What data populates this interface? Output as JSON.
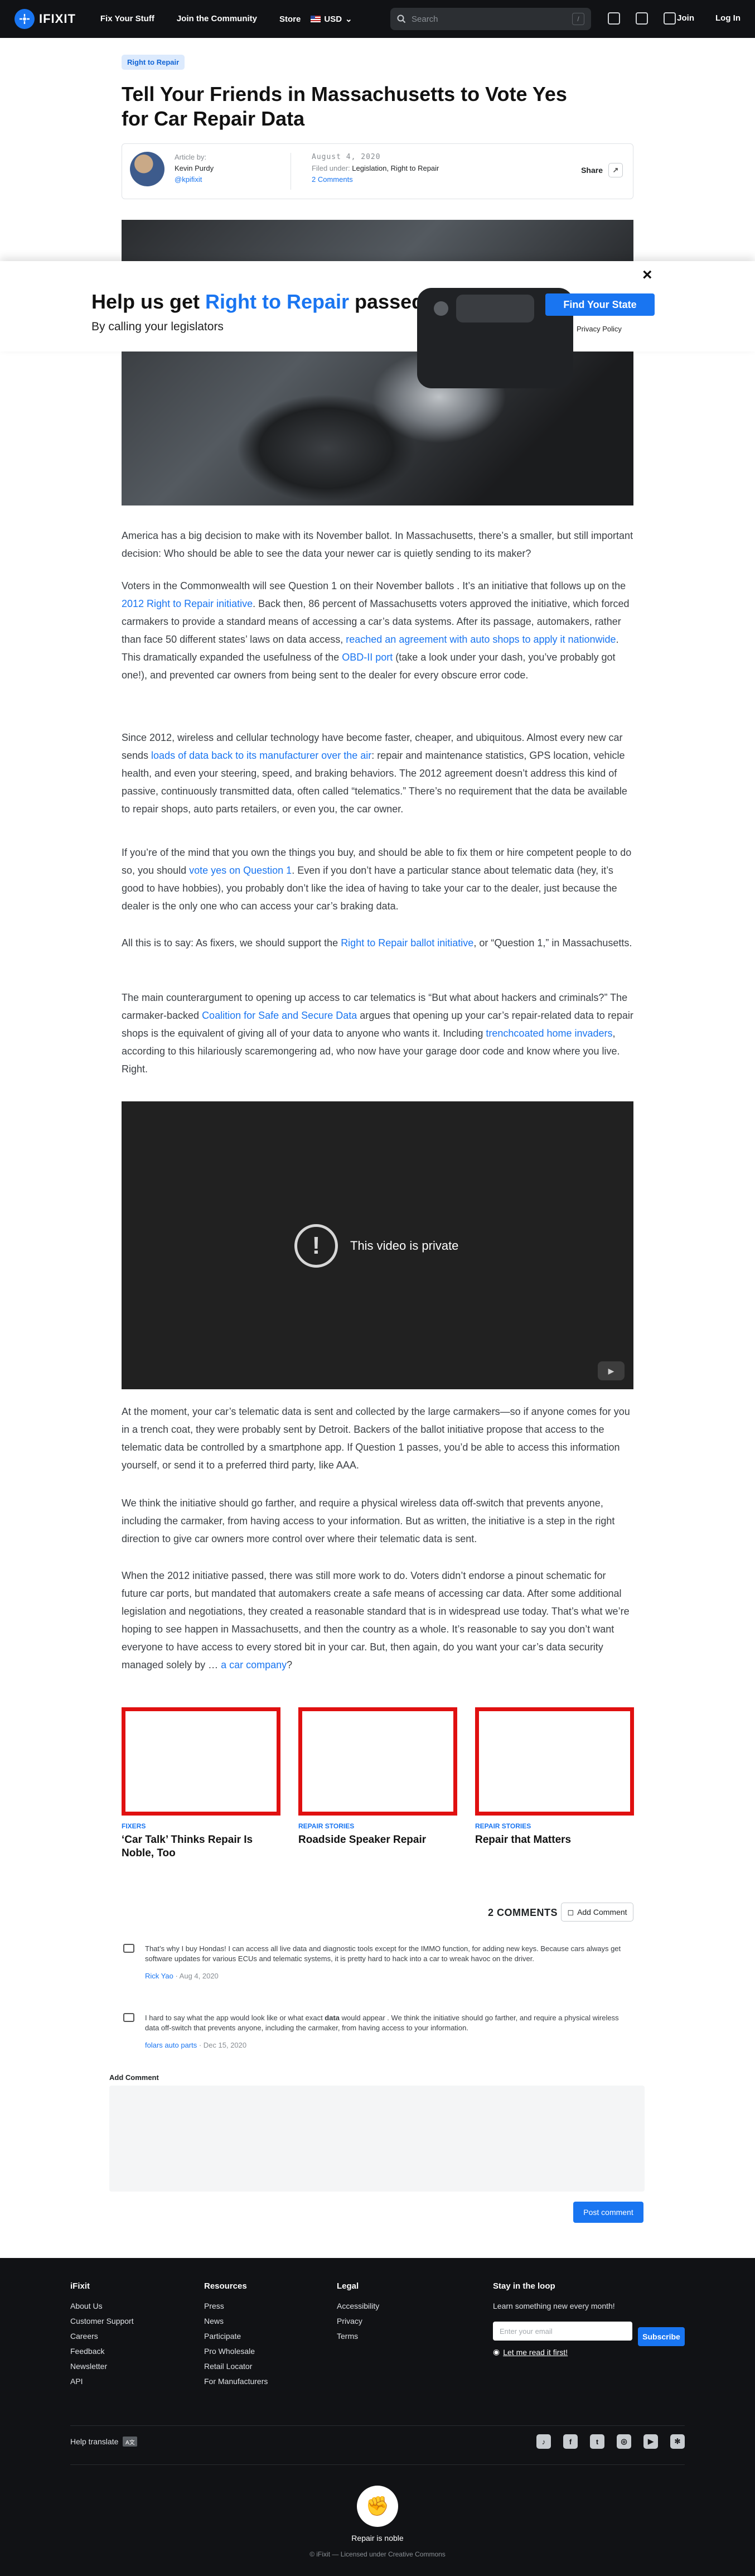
{
  "nav": {
    "logo": "IFIXIT",
    "links": [
      "Fix Your Stuff",
      "Join the Community",
      "Store"
    ],
    "currency": "USD",
    "search_placeholder": "Search",
    "search_shortcut": "/",
    "join": "Join",
    "login": "Log In"
  },
  "article": {
    "tag": "Right to Repair",
    "title": "Tell Your Friends in Massachusetts to Vote Yes for Car Repair Data",
    "article_by_label": "Article by:",
    "author": "Kevin Purdy",
    "handle": "@kpifixit",
    "date": "August 4, 2020",
    "filed_under_label": "Filed under:",
    "filed_under": "Legislation, Right to Repair",
    "comments_count": "2 Comments",
    "share": "Share"
  },
  "popup": {
    "title_before": "Help us get ",
    "title_accent": "Right to Repair",
    "title_after": " passed",
    "subtitle": "By calling your legislators",
    "button": "Find Your State",
    "privacy": "Privacy Policy",
    "close": "×"
  },
  "body": {
    "p1": "America has a big decision to make with its November ballot. In Massachusetts, there’s a smaller, but still important decision: Who should be able to see the data your newer car is quietly sending to its maker?",
    "p2": {
      "a": "Voters in the Commonwealth will see Question 1 on their November ballots . It’s an initiative that follows up on the ",
      "l1": "2012 Right to Repair initiative",
      "b": ". Back then, 86 percent of Massachusetts voters approved the initiative, which forced carmakers to provide a standard means of accessing a car’s data systems. After its passage, automakers, rather than face 50 different states’ laws on data access, ",
      "l2": "reached an agreement with auto shops to apply it nationwide",
      "c": ". This dramatically expanded the usefulness of the ",
      "l3": "OBD-II port",
      "d": " (take a look under your dash, you’ve probably got one!), and prevented car owners from being sent to the dealer for every obscure error code."
    },
    "p3": {
      "a": "Since 2012, wireless and cellular technology have become faster, cheaper, and ubiquitous. Almost every new car sends ",
      "l1": "loads of data back to its manufacturer over the air",
      "b": ": repair and maintenance statistics, GPS location, vehicle health, and even your steering, speed, and braking behaviors. The 2012 agreement doesn’t address this kind of passive, continuously transmitted data, often called “telematics.” There’s no requirement that the data be available to repair shops, auto parts retailers, or even you, the car owner."
    },
    "p4": {
      "a": "If you’re of the mind that you own the things you buy, and should be able to fix them or hire competent people to do so, you should ",
      "l1": "vote yes on Question 1",
      "b": ". Even if you don’t have a particular stance about telematic data (hey, it’s good to have hobbies), you probably don’t like the idea of having to take your car to the dealer, just because the dealer is the only one who can access your car’s braking data."
    },
    "p5": {
      "a": "All this is to say: As fixers, we should support the ",
      "l1": "Right to Repair ballot initiative",
      "b": ", or “Question 1,” in Massachusetts."
    },
    "p6": {
      "a": "The main counterargument to opening up access to car telematics is “But what about hackers and criminals?” The carmaker-backed ",
      "l1": "Coalition for Safe and Secure Data",
      "b": " argues that opening up your car’s repair-related data to repair shops is the equivalent of giving all of your data to anyone who wants it. Including ",
      "l2": "trenchcoated home invaders",
      "c": ", according to this hilariously scaremongering ad, who now have your garage door code and know where you live. Right."
    },
    "video_message": "This video is private",
    "video_icon": "!",
    "p7": "At the moment, your car’s telematic data is sent and collected by the large carmakers—so if anyone comes for you in a trench coat, they were probably sent by Detroit. Backers of the ballot initiative propose that access to the telematic data be controlled by a smartphone app. If Question 1 passes, you’d be able to access this information yourself, or send it to a preferred third party, like AAA.",
    "p8": "We think the initiative should go farther, and require a physical wireless data off-switch that prevents anyone, including the carmaker, from having access to your information. But as written, the initiative is a step in the right direction to give car owners more control over where their telematic data is sent.",
    "p9": {
      "a": "When the 2012 initiative passed, there was still more work to do. Voters didn’t endorse a pinout schematic for future car ports, but mandated that automakers create a safe means of accessing car data. After some additional legislation and negotiations, they created a reasonable standard that is in widespread use today. That’s what we’re hoping to see happen in Massachusetts, and then the country as a whole. It’s reasonable to say you don’t want everyone to have access to every stored bit in your car. But, then again, do you want your car’s data security managed solely by … ",
      "l1": "a car company",
      "b": "?"
    }
  },
  "related": [
    {
      "kicker": "FIXERS",
      "title": "‘Car Talk’ Thinks Repair Is Noble, Too"
    },
    {
      "kicker": "REPAIR STORIES",
      "title": "Roadside Speaker Repair"
    },
    {
      "kicker": "REPAIR STORIES",
      "title": "Repair that Matters"
    }
  ],
  "comments": {
    "count_label": "2 COMMENTS",
    "add_button": "Add Comment",
    "items": [
      {
        "text": "That’s why I buy Hondas! I can access all live data and diagnostic tools except for the IMMO function, for adding new keys. Because cars always get software updates for various ECUs and telematic systems, it is pretty hard to hack into a car to wreak havoc on the driver.",
        "author": "Rick Yao",
        "date": "Aug 4, 2020"
      },
      {
        "text_a": "I hard to say what the app would look like or what exact ",
        "text_bold": "data",
        "text_b": " would appear . We think the initiative should go farther, and require a physical wireless data off-switch that prevents anyone, including the carmaker, from having access to your information.",
        "author": "folars auto parts",
        "date": "Dec 15, 2020"
      }
    ],
    "add_label": "Add Comment",
    "post_button": "Post comment"
  },
  "footer": {
    "col1": {
      "head": "iFixit",
      "items": [
        "About Us",
        "Customer Support",
        "Careers",
        "Feedback",
        "Newsletter",
        "API"
      ]
    },
    "col2": {
      "head": "Resources",
      "items": [
        "Press",
        "News",
        "Participate",
        "Pro Wholesale",
        "Retail Locator",
        "For Manufacturers"
      ]
    },
    "col3": {
      "head": "Legal",
      "items": [
        "Accessibility",
        "Privacy",
        "Terms"
      ]
    },
    "col4": {
      "head": "Stay in the loop",
      "sub": "Learn something new every month!",
      "placeholder": "Enter your email",
      "button": "Subscribe",
      "read_first": "Let me read it first!"
    },
    "help_translate": "Help translate",
    "tagline": "Repair is noble",
    "license": "© iFixit — Licensed under Creative Commons"
  }
}
